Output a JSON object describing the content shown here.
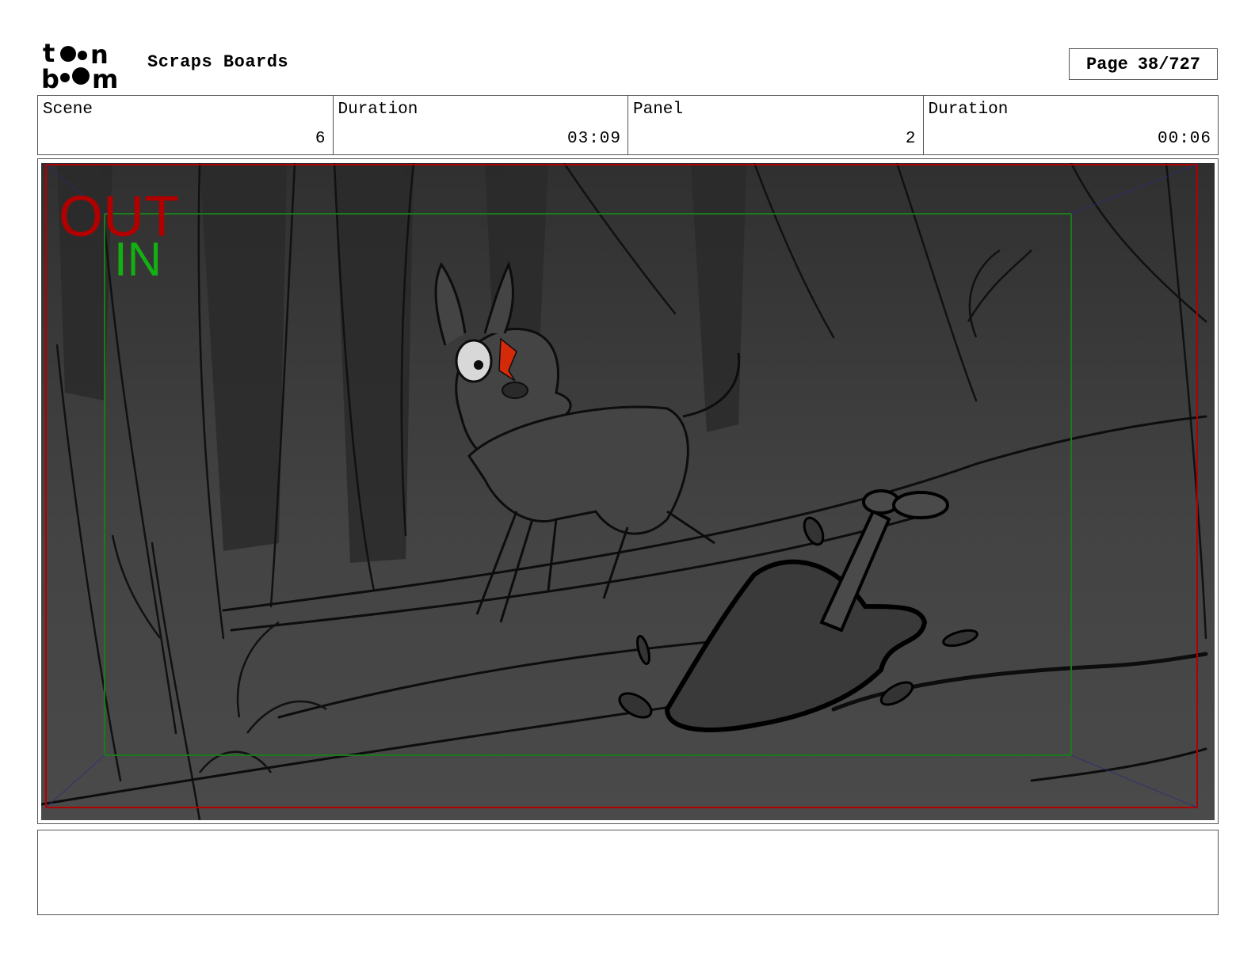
{
  "header": {
    "logo_text": "toon boom",
    "project_title": "Scraps Boards",
    "page_label": "Page",
    "page_value": "38/727"
  },
  "info": [
    {
      "label": "Scene",
      "value": "6"
    },
    {
      "label": "Duration",
      "value": "03:09"
    },
    {
      "label": "Panel",
      "value": "2"
    },
    {
      "label": "Duration",
      "value": "00:06"
    }
  ],
  "panel": {
    "out_label": "OUT",
    "in_label": "IN",
    "colors": {
      "background": "#3e3e3e",
      "out_frame": "#b00000",
      "in_frame": "#1b7a1b",
      "in_text": "#13b013",
      "line": "#0d0d0d",
      "accent": "#d42a0a"
    }
  },
  "notes": {
    "text": ""
  }
}
